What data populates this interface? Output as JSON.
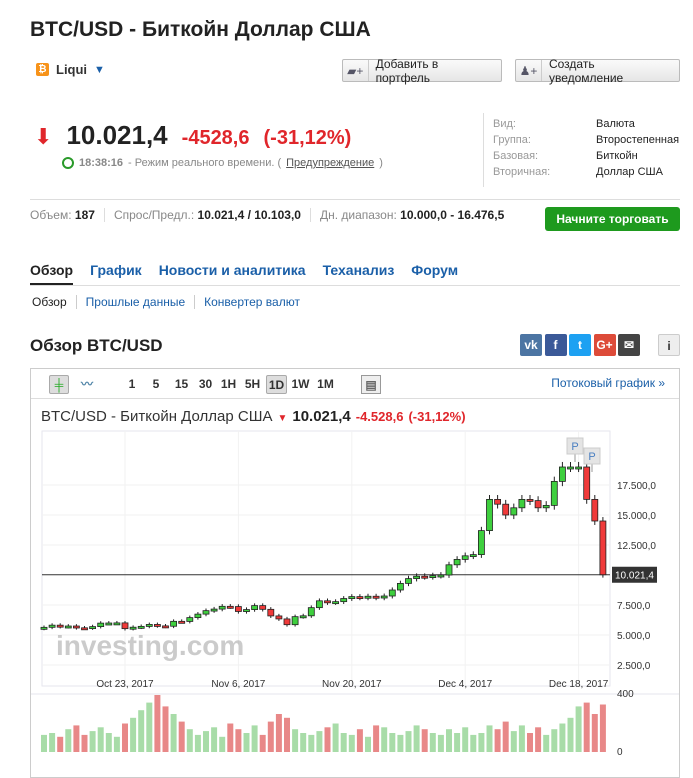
{
  "header": {
    "title": "BTC/USD - Биткойн Доллар США",
    "exchange": "Liqui",
    "add_portfolio": "Добавить в портфель",
    "create_alert": "Создать уведомление"
  },
  "quote": {
    "last": "10.021,4",
    "change": "-4528,6",
    "change_pct": "(-31,12%)",
    "time": "18:38:16",
    "time_text": "- Режим реального времени. (",
    "warning_link": "Предупреждение",
    "close_paren": ")"
  },
  "info": [
    {
      "k": "Вид:",
      "v": "Валюта"
    },
    {
      "k": "Группа:",
      "v": "Второстепенная"
    },
    {
      "k": "Базовая:",
      "v": "Биткойн"
    },
    {
      "k": "Вторичная:",
      "v": "Доллар США"
    }
  ],
  "stats": {
    "volume_label": "Объем:",
    "volume": "187",
    "bidask_label": "Спрос/Предл.:",
    "bidask": "10.021,4 / 10.103,0",
    "range_label": "Дн. диапазон:",
    "range": "10.000,0 - 16.476,5",
    "trade_button": "Начните торговать"
  },
  "tabs": [
    "Обзор",
    "График",
    "Новости и аналитика",
    "Теханализ",
    "Форум"
  ],
  "subtabs": [
    "Обзор",
    "Прошлые данные",
    "Конвертер валют"
  ],
  "overview_title": "Обзор BTC/USD",
  "social": [
    {
      "n": "vk",
      "t": "vk",
      "c": "#4c75a3"
    },
    {
      "n": "facebook",
      "t": "f",
      "c": "#3b5998"
    },
    {
      "n": "twitter",
      "t": "t",
      "c": "#1da1f2"
    },
    {
      "n": "google-plus",
      "t": "G+",
      "c": "#dd4b39"
    },
    {
      "n": "email",
      "t": "✉",
      "c": "#444"
    }
  ],
  "toolbar": {
    "intervals": [
      "1",
      "5",
      "15",
      "30",
      "1H",
      "5H",
      "1D",
      "1W",
      "1M"
    ],
    "selected": "1D",
    "stream_link": "Потоковый график »"
  },
  "chart_header": {
    "title": "BTC/USD - Биткойн Доллар США",
    "last": "10.021,4",
    "change": "-4.528,6",
    "change_pct": "(-31,12%)"
  },
  "chart_data": {
    "type": "candlestick",
    "ylim": [
      0,
      20000
    ],
    "yticks": [
      2500,
      5000,
      7500,
      12500,
      15000,
      17500
    ],
    "ytick_labels": [
      "2.500,0",
      "5.000,0",
      "7.500,0",
      "12.500,0",
      "15.000,0",
      "17.500,0"
    ],
    "last_price": 10021.4,
    "last_label": "10.021,4",
    "xtick_labels": [
      "Oct 23, 2017",
      "Nov 6, 2017",
      "Nov 20, 2017",
      "Dec 4, 2017",
      "Dec 18, 2017"
    ],
    "xtick_index": [
      10,
      24,
      38,
      52,
      66
    ],
    "first_open": 5550,
    "closes": [
      5640,
      5820,
      5700,
      5750,
      5600,
      5580,
      5700,
      5990,
      6000,
      6010,
      5530,
      5650,
      5720,
      5880,
      5760,
      5730,
      6140,
      6130,
      6450,
      6740,
      7030,
      7160,
      7390,
      7370,
      6960,
      7120,
      7450,
      7140,
      6590,
      6340,
      5860,
      6530,
      6600,
      7280,
      7850,
      7700,
      7780,
      8040,
      8200,
      8100,
      8230,
      8100,
      8250,
      8750,
      9300,
      9700,
      9900,
      9850,
      9950,
      10000,
      10850,
      11300,
      11600,
      11700,
      13700,
      16300,
      15900,
      15000,
      15600,
      16300,
      16200,
      15600,
      15800,
      17800,
      19000,
      19000,
      19000,
      16300,
      14500,
      10021
    ],
    "volume_ylim": [
      0,
      400
    ],
    "volume_labels": [
      "400",
      "0"
    ],
    "volumes": [
      90,
      100,
      80,
      120,
      140,
      90,
      110,
      130,
      100,
      80,
      150,
      180,
      220,
      260,
      300,
      240,
      200,
      160,
      120,
      90,
      110,
      130,
      80,
      150,
      120,
      100,
      140,
      90,
      160,
      200,
      180,
      120,
      100,
      90,
      110,
      130,
      150,
      100,
      90,
      120,
      80,
      140,
      130,
      100,
      90,
      110,
      140,
      120,
      100,
      90,
      120,
      100,
      130,
      90,
      100,
      140,
      120,
      160,
      110,
      140,
      100,
      130,
      90,
      120,
      150,
      180,
      240,
      260,
      200,
      250
    ],
    "markers": [
      "P",
      "P"
    ],
    "watermark": "investing.com"
  }
}
